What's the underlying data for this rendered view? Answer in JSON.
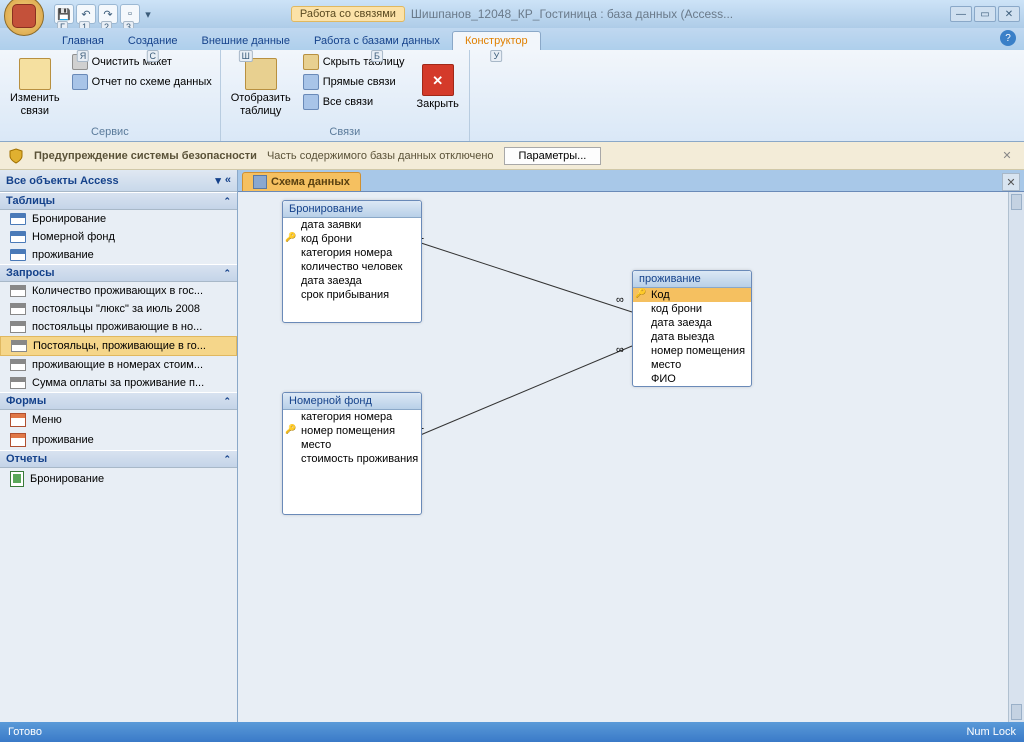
{
  "qat": {
    "labels": [
      "Г",
      "1",
      "2",
      "3"
    ]
  },
  "title": {
    "context": "Работа со связями",
    "doc": "Шишпанов_12048_КР_Гостиница : база данных (Access..."
  },
  "ribbon_tabs": {
    "items": [
      {
        "label": "Главная",
        "key": "Я"
      },
      {
        "label": "Создание",
        "key": "С"
      },
      {
        "label": "Внешние данные",
        "key": "Ш"
      },
      {
        "label": "Работа с базами данных",
        "key": "Б"
      },
      {
        "label": "Конструктор",
        "key": "У",
        "active": true
      }
    ]
  },
  "ribbon": {
    "group1": {
      "title": "Сервис",
      "edit": "Изменить\nсвязи",
      "clear": "Очистить макет",
      "report": "Отчет по схеме данных"
    },
    "group2": {
      "title": "Связи",
      "show_table": "Отобразить\nтаблицу",
      "hide_table": "Скрыть таблицу",
      "direct": "Прямые связи",
      "all": "Все связи",
      "close": "Закрыть"
    }
  },
  "security": {
    "title": "Предупреждение системы безопасности",
    "msg": "Часть содержимого базы данных отключено",
    "btn": "Параметры..."
  },
  "nav": {
    "header": "Все объекты Access",
    "sections": {
      "tables": {
        "title": "Таблицы",
        "items": [
          "Бронирование",
          "Номерной фонд",
          "проживание"
        ]
      },
      "queries": {
        "title": "Запросы",
        "items": [
          "Количество проживающих в гос...",
          "постояльцы \"люкс\" за июль 2008",
          "постояльцы проживающие в но...",
          "Постояльцы, проживающие в го...",
          "проживающие в номерах стоим...",
          "Сумма оплаты за проживание п..."
        ],
        "selected": 3
      },
      "forms": {
        "title": "Формы",
        "items": [
          "Меню",
          "проживание"
        ]
      },
      "reports": {
        "title": "Отчеты",
        "items": [
          "Бронирование"
        ]
      }
    }
  },
  "doc_tab": "Схема данных",
  "tables": {
    "t1": {
      "title": "Бронирование",
      "fields": [
        "дата заявки",
        "код брони",
        "категория номера",
        "количество человек",
        "дата заезда",
        "срок прибывания"
      ],
      "pk": 1
    },
    "t2": {
      "title": "Номерной фонд",
      "fields": [
        "категория номера",
        "номер помещения",
        "место",
        "стоимость проживания"
      ],
      "pk": 1
    },
    "t3": {
      "title": "проживание",
      "fields": [
        "Код",
        "код брони",
        "дата заезда",
        "дата выезда",
        "номер помещения",
        "место",
        "ФИО"
      ],
      "pk": 0,
      "sel": 0
    }
  },
  "rel": {
    "one": "1",
    "many": "∞"
  },
  "status": {
    "left": "Готово",
    "right": "Num Lock"
  }
}
